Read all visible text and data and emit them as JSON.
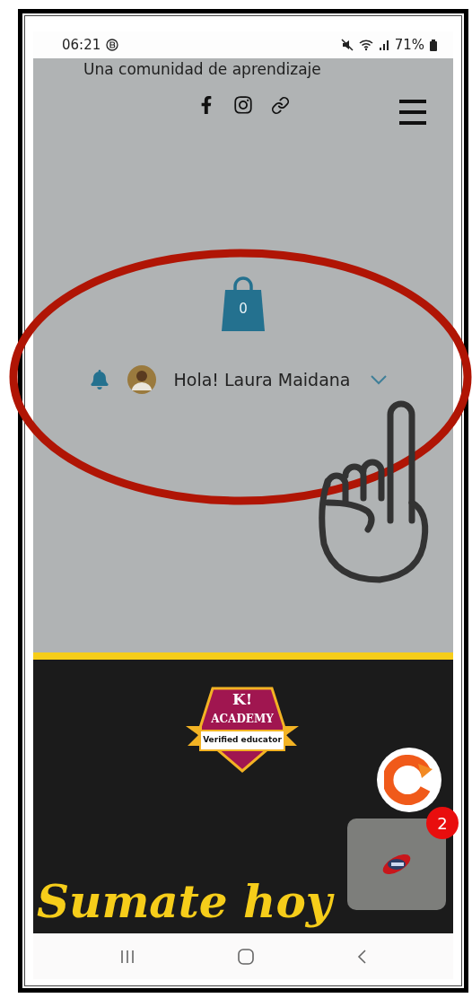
{
  "status_bar": {
    "time": "06:21",
    "battery": "71%"
  },
  "header": {
    "tagline": "Una comunidad de aprendizaje"
  },
  "cart": {
    "count": "0"
  },
  "user": {
    "greeting": "Hola! Laura Maidana"
  },
  "banner": {
    "badge": {
      "logo": "K!",
      "title": "ACADEMY",
      "ribbon": "Verified educator"
    },
    "headline": "Sumate hoy"
  },
  "chat_bubble": {
    "unread": "2"
  }
}
